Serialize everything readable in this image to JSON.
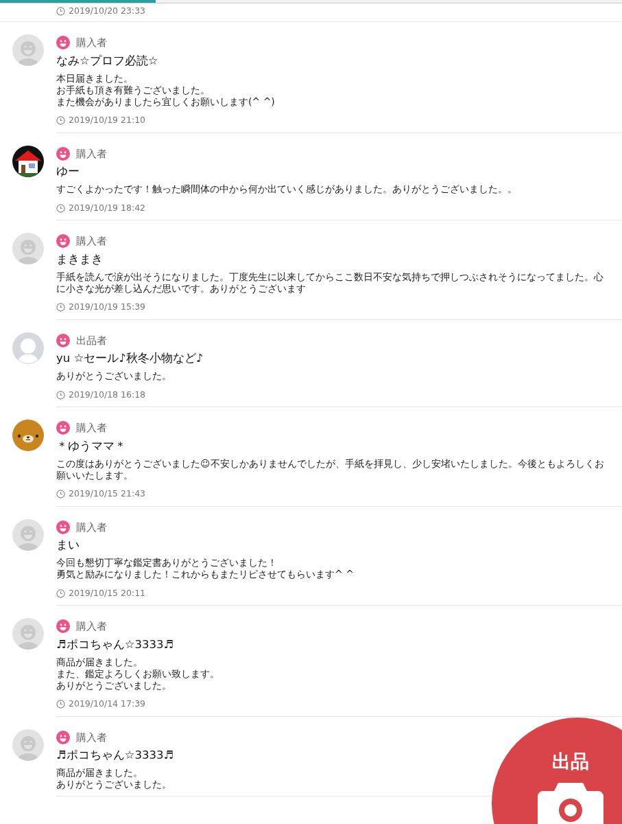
{
  "progress": {
    "level": 0.25
  },
  "top_date": "2019/10/20 23:33",
  "comments": [
    {
      "avatar": {
        "kind": "default"
      },
      "role": "購入者",
      "name": "なみ☆プロフ必読☆",
      "lines": [
        "本日届きました。",
        "お手紙も頂き有難うございました。",
        "また機会がありましたら宜しくお願いします(^ ^)"
      ],
      "date": "2019/10/19 21:10"
    },
    {
      "avatar": {
        "kind": "house"
      },
      "role": "購入者",
      "name": "ゆー",
      "lines": [
        "すごくよかったです！触った瞬間体の中から何か出ていく感じがありました。ありがとうございました。。"
      ],
      "date": "2019/10/19 18:42"
    },
    {
      "avatar": {
        "kind": "default"
      },
      "role": "購入者",
      "name": "まきまき",
      "lines": [
        "手紙を読んで涙が出そうになりました。丁度先生に以来してからここ数日不安な気持ちで押しつぶされそうになってました。心に小さな光が差し込んだ思いです。ありがとうございます"
      ],
      "date": "2019/10/19 15:39"
    },
    {
      "avatar": {
        "kind": "silhouette"
      },
      "role": "出品者",
      "name": "yu ☆セール♪秋冬小物など♪",
      "lines": [
        "ありがとうございました。"
      ],
      "date": "2019/10/18 16:18"
    },
    {
      "avatar": {
        "kind": "bear"
      },
      "role": "購入者",
      "name": "＊ゆうママ＊",
      "lines": [
        "この度はありがとうございました☺不安しかありませんでしたが、手紙を拝見し、少し安堵いたしました。今後ともよろしくお願いいたします。"
      ],
      "date": "2019/10/15 21:43"
    },
    {
      "avatar": {
        "kind": "default"
      },
      "role": "購入者",
      "name": "まい",
      "lines": [
        "今回も懇切丁寧な鑑定書ありがとうございました！",
        "勇気と励みになりました！これからもまたリピさせてもらいます^ ^"
      ],
      "date": "2019/10/15 20:11"
    },
    {
      "avatar": {
        "kind": "default"
      },
      "role": "購入者",
      "name": "♬ポコちゃん☆3333♬",
      "lines": [
        "商品が届きました。",
        "また、鑑定よろしくお願い致します。",
        "ありがとうございました。"
      ],
      "date": "2019/10/14 17:39"
    },
    {
      "avatar": {
        "kind": "default"
      },
      "role": "購入者",
      "name": "♬ポコちゃん☆3333♬",
      "lines": [
        "商品が届きました。",
        "ありがとうございました。"
      ]
    }
  ],
  "fab": {
    "label": "出品"
  }
}
